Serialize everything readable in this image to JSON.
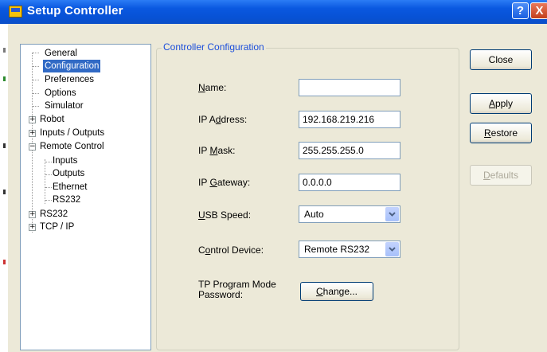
{
  "window": {
    "title": "Setup Controller",
    "help_glyph": "?",
    "close_glyph": "X"
  },
  "tree": {
    "items": [
      {
        "label": "General"
      },
      {
        "label": "Configuration"
      },
      {
        "label": "Preferences"
      },
      {
        "label": "Options"
      },
      {
        "label": "Simulator"
      },
      {
        "label": "Robot"
      },
      {
        "label": "Inputs / Outputs"
      },
      {
        "label": "Remote Control"
      },
      {
        "label": "Inputs"
      },
      {
        "label": "Outputs"
      },
      {
        "label": "Ethernet"
      },
      {
        "label": "RS232"
      },
      {
        "label": "RS232"
      },
      {
        "label": "TCP / IP"
      }
    ],
    "selected": "Configuration"
  },
  "group": {
    "title": "Controller Configuration",
    "name_label_u": "N",
    "name_label_rest": "ame:",
    "name_value": "",
    "ip_label_pre": "IP A",
    "ip_label_u": "d",
    "ip_label_post": "dress:",
    "ip_value": "192.168.219.216",
    "mask_label_pre": "IP ",
    "mask_label_u": "M",
    "mask_label_post": "ask:",
    "mask_value": "255.255.255.0",
    "gw_label_pre": "IP ",
    "gw_label_u": "G",
    "gw_label_post": "ateway:",
    "gw_value": "0.0.0.0",
    "usb_label_u": "U",
    "usb_label_rest": "SB Speed:",
    "usb_value": "Auto",
    "ctrl_label_pre": "C",
    "ctrl_label_u": "o",
    "ctrl_label_post": "ntrol Device:",
    "ctrl_value": "Remote RS232",
    "tp_label_line1": "TP Program Mode",
    "tp_label_line2": "Password:",
    "change_u": "C",
    "change_rest": "hange..."
  },
  "buttons": {
    "close": "Close",
    "apply_u": "A",
    "apply_rest": "pply",
    "restore_u": "R",
    "restore_rest": "estore",
    "defaults_u": "D",
    "defaults_rest": "efaults"
  },
  "colors": {
    "titlebar": "#0a58e0",
    "selection": "#316ac5",
    "group_title": "#1c4fdb"
  }
}
